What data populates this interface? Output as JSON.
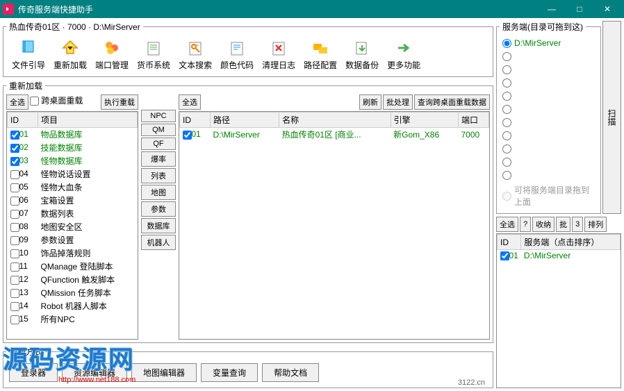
{
  "window": {
    "title": "传奇服务端快捷助手",
    "min": "—",
    "max": "□",
    "close": "✕"
  },
  "mainGroup": "热血传奇01区 · 7000 · D:\\MirServer",
  "toolbar": [
    {
      "label": "文件引导",
      "icon": "file"
    },
    {
      "label": "重新加载",
      "icon": "reload"
    },
    {
      "label": "端口管理",
      "icon": "port"
    },
    {
      "label": "货币系统",
      "icon": "money"
    },
    {
      "label": "文本搜索",
      "icon": "search"
    },
    {
      "label": "颜色代码",
      "icon": "color"
    },
    {
      "label": "清理日志",
      "icon": "clean"
    },
    {
      "label": "路径配置",
      "icon": "path"
    },
    {
      "label": "数据备份",
      "icon": "backup"
    },
    {
      "label": "更多功能",
      "icon": "more"
    }
  ],
  "reload": {
    "legend": "重新加载",
    "selectAll": "全选",
    "crossDesktop": "跨桌面重载",
    "execute": "执行重载",
    "cols": {
      "id": "ID",
      "item": "项目"
    },
    "items": [
      {
        "id": "01",
        "name": "物品数据库",
        "checked": true,
        "green": true
      },
      {
        "id": "02",
        "name": "技能数据库",
        "checked": true,
        "green": true
      },
      {
        "id": "03",
        "name": "怪物数据库",
        "checked": true,
        "green": true
      },
      {
        "id": "04",
        "name": "怪物说话设置",
        "checked": false
      },
      {
        "id": "05",
        "name": "怪物大血条",
        "checked": false
      },
      {
        "id": "06",
        "name": "宝箱设置",
        "checked": false
      },
      {
        "id": "07",
        "name": "数据列表",
        "checked": false
      },
      {
        "id": "08",
        "name": "地图安全区",
        "checked": false
      },
      {
        "id": "09",
        "name": "参数设置",
        "checked": false
      },
      {
        "id": "10",
        "name": "饰品掉落规则",
        "checked": false
      },
      {
        "id": "11",
        "name": "QManage 登陆脚本",
        "checked": false
      },
      {
        "id": "12",
        "name": "QFunction 触发脚本",
        "checked": false
      },
      {
        "id": "13",
        "name": "QMission 任务脚本",
        "checked": false
      },
      {
        "id": "14",
        "name": "Robot 机器人脚本",
        "checked": false
      },
      {
        "id": "15",
        "name": "所有NPC",
        "checked": false
      }
    ],
    "midBtns": [
      "NPC",
      "QM",
      "QF",
      "爆率",
      "列表",
      "地图",
      "参数",
      "数据库",
      "机器人"
    ],
    "rightBtns": {
      "selectAll": "全选",
      "refresh": "刷新",
      "batch": "批处理",
      "query": "查询跨桌面重载数据"
    },
    "rightCols": {
      "id": "ID",
      "path": "路径",
      "name": "名称",
      "engine": "引擎",
      "port": "端口"
    },
    "rightRows": [
      {
        "id": "01",
        "path": "D:\\MirServer",
        "name": "热血传奇01区 [商业...",
        "engine": "新Gom_X86",
        "port": "7000",
        "checked": true
      }
    ]
  },
  "shortcut": {
    "legend": "快捷方式",
    "btns": [
      "登录器",
      "资源编辑器",
      "地图编辑器",
      "变量查询",
      "帮助文档"
    ]
  },
  "server": {
    "legend": "服务端(目录可拖到这)",
    "scan": "扫描",
    "radios": [
      "D:\\MirServer"
    ],
    "emptyRadios": 10,
    "dragHint": "可将服务端目录拖到上面"
  },
  "srvList": {
    "btns": {
      "selectAll": "全选",
      "q": "?",
      "fold": "收纳",
      "batch": "批",
      "num": "3",
      "sort": "排列"
    },
    "cols": {
      "id": "ID",
      "name": "服务端（点击排序）"
    },
    "rows": [
      {
        "id": "01",
        "name": "D:\\MirServer",
        "checked": true
      }
    ]
  },
  "footer": "3122.cn",
  "watermark": {
    "text": "源码资源网",
    "url": "http://www.net188.com"
  }
}
